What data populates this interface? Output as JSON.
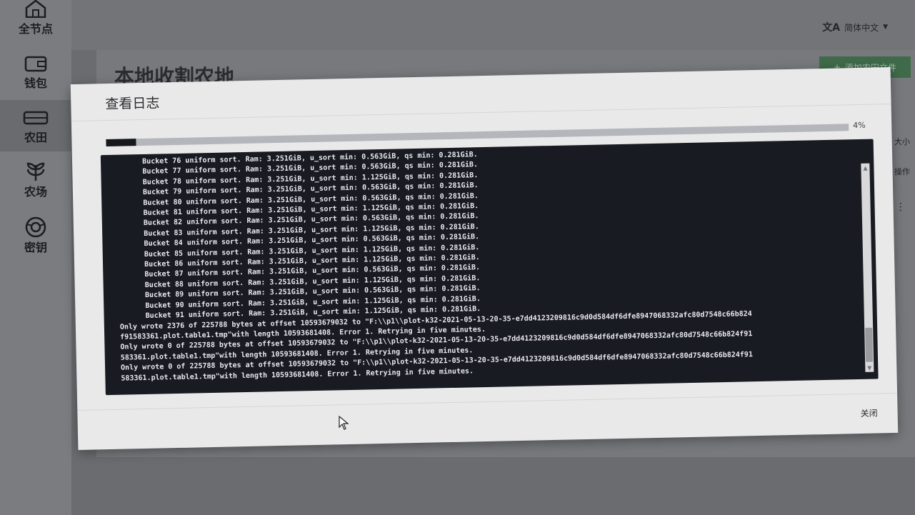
{
  "sidebar": {
    "items": [
      {
        "label": "全节点",
        "icon": "home-icon"
      },
      {
        "label": "钱包",
        "icon": "wallet-icon"
      },
      {
        "label": "农田",
        "icon": "drive-icon"
      },
      {
        "label": "农场",
        "icon": "plant-icon"
      },
      {
        "label": "密钥",
        "icon": "lifebuoy-icon"
      }
    ]
  },
  "topbar": {
    "language": "简体中文",
    "language_icon": "translate-icon"
  },
  "page": {
    "title": "本地收割农地",
    "add_button": "添加农田文件",
    "col_size": "大小",
    "col_action": "操作"
  },
  "modal": {
    "title": "查看日志",
    "progress_percent": 4,
    "progress_label": "4%",
    "close_label": "关闭",
    "log_lines": [
      "      Bucket 76 uniform sort. Ram: 3.251GiB, u_sort min: 0.563GiB, qs min: 0.281GiB.",
      "      Bucket 77 uniform sort. Ram: 3.251GiB, u_sort min: 0.563GiB, qs min: 0.281GiB.",
      "      Bucket 78 uniform sort. Ram: 3.251GiB, u_sort min: 1.125GiB, qs min: 0.281GiB.",
      "      Bucket 79 uniform sort. Ram: 3.251GiB, u_sort min: 0.563GiB, qs min: 0.281GiB.",
      "      Bucket 80 uniform sort. Ram: 3.251GiB, u_sort min: 0.563GiB, qs min: 0.281GiB.",
      "      Bucket 81 uniform sort. Ram: 3.251GiB, u_sort min: 1.125GiB, qs min: 0.281GiB.",
      "      Bucket 82 uniform sort. Ram: 3.251GiB, u_sort min: 0.563GiB, qs min: 0.281GiB.",
      "      Bucket 83 uniform sort. Ram: 3.251GiB, u_sort min: 1.125GiB, qs min: 0.281GiB.",
      "      Bucket 84 uniform sort. Ram: 3.251GiB, u_sort min: 0.563GiB, qs min: 0.281GiB.",
      "      Bucket 85 uniform sort. Ram: 3.251GiB, u_sort min: 1.125GiB, qs min: 0.281GiB.",
      "      Bucket 86 uniform sort. Ram: 3.251GiB, u_sort min: 1.125GiB, qs min: 0.281GiB.",
      "      Bucket 87 uniform sort. Ram: 3.251GiB, u_sort min: 0.563GiB, qs min: 0.281GiB.",
      "      Bucket 88 uniform sort. Ram: 3.251GiB, u_sort min: 1.125GiB, qs min: 0.281GiB.",
      "      Bucket 89 uniform sort. Ram: 3.251GiB, u_sort min: 0.563GiB, qs min: 0.281GiB.",
      "      Bucket 90 uniform sort. Ram: 3.251GiB, u_sort min: 1.125GiB, qs min: 0.281GiB.",
      "      Bucket 91 uniform sort. Ram: 3.251GiB, u_sort min: 1.125GiB, qs min: 0.281GiB.",
      "Only wrote 2376 of 225788 bytes at offset 10593679032 to \"F:\\\\p1\\\\plot-k32-2021-05-13-20-35-e7dd4123209816c9d0d584df6dfe8947068332afc80d7548c66b824",
      "f91583361.plot.table1.tmp\"with length 10593681408. Error 1. Retrying in five minutes.",
      "Only wrote 0 of 225788 bytes at offset 10593679032 to \"F:\\\\p1\\\\plot-k32-2021-05-13-20-35-e7dd4123209816c9d0d584df6dfe8947068332afc80d7548c66b824f91",
      "583361.plot.table1.tmp\"with length 10593681408. Error 1. Retrying in five minutes.",
      "Only wrote 0 of 225788 bytes at offset 10593679032 to \"F:\\\\p1\\\\plot-k32-2021-05-13-20-35-e7dd4123209816c9d0d584df6dfe8947068332afc80d7548c66b824f91",
      "583361.plot.table1.tmp\"with length 10593681408. Error 1. Retrying in five minutes."
    ]
  },
  "colors": {
    "log_background": "#191b22",
    "log_text": "#e9e9ee",
    "progress_fill": "#16181c",
    "accent_green": "#3f6b4a"
  }
}
